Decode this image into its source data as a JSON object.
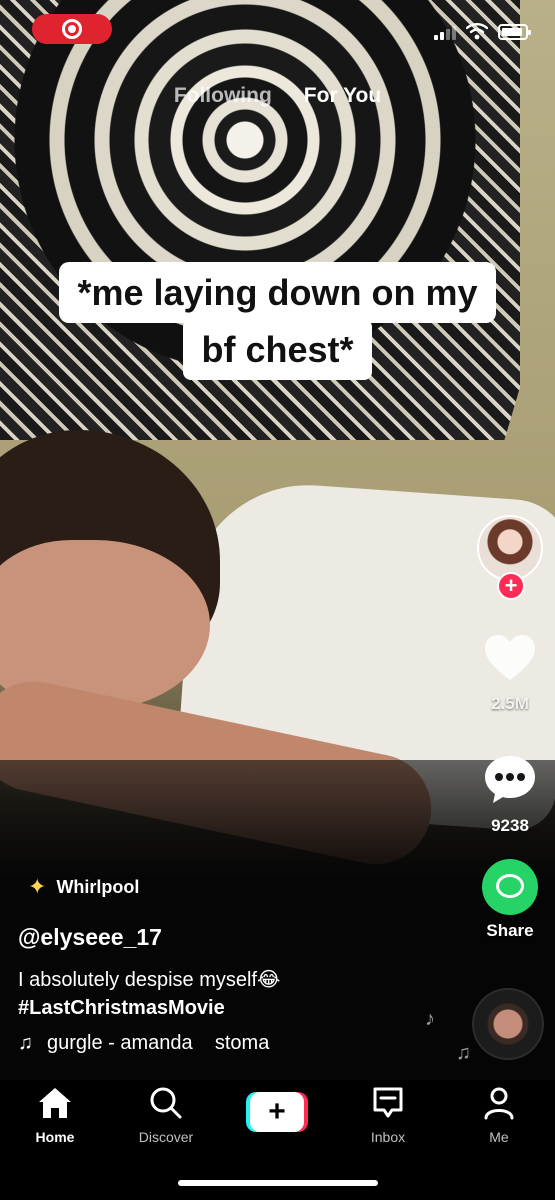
{
  "status_bar": {
    "recording_icon": "screen-record-icon",
    "signal_icon": "cellular-signal-icon",
    "wifi_icon": "wifi-icon",
    "battery_icon": "battery-icon"
  },
  "top_tabs": {
    "following": "Following",
    "for_you": "For You",
    "active": "For You"
  },
  "caption": {
    "line1": "*me laying down on my",
    "line2": "bf chest*"
  },
  "rail": {
    "like_count": "2.5M",
    "comment_count": "9238",
    "share_label": "Share",
    "follow_symbol": "+"
  },
  "post": {
    "effect_name": "Whirlpool",
    "username": "@elyseee_17",
    "description": "I absolutely despise myself😂",
    "hashtag": "#LastChristmasMovie",
    "music": "gurgle - amanda    stoma"
  },
  "bottom_nav": {
    "home": "Home",
    "discover": "Discover",
    "create_symbol": "+",
    "inbox": "Inbox",
    "me": "Me"
  },
  "colors": {
    "record_red": "#e0242f",
    "follow_pink": "#fe2c55",
    "share_green": "#25d366",
    "create_cyan": "#25f4ee"
  }
}
